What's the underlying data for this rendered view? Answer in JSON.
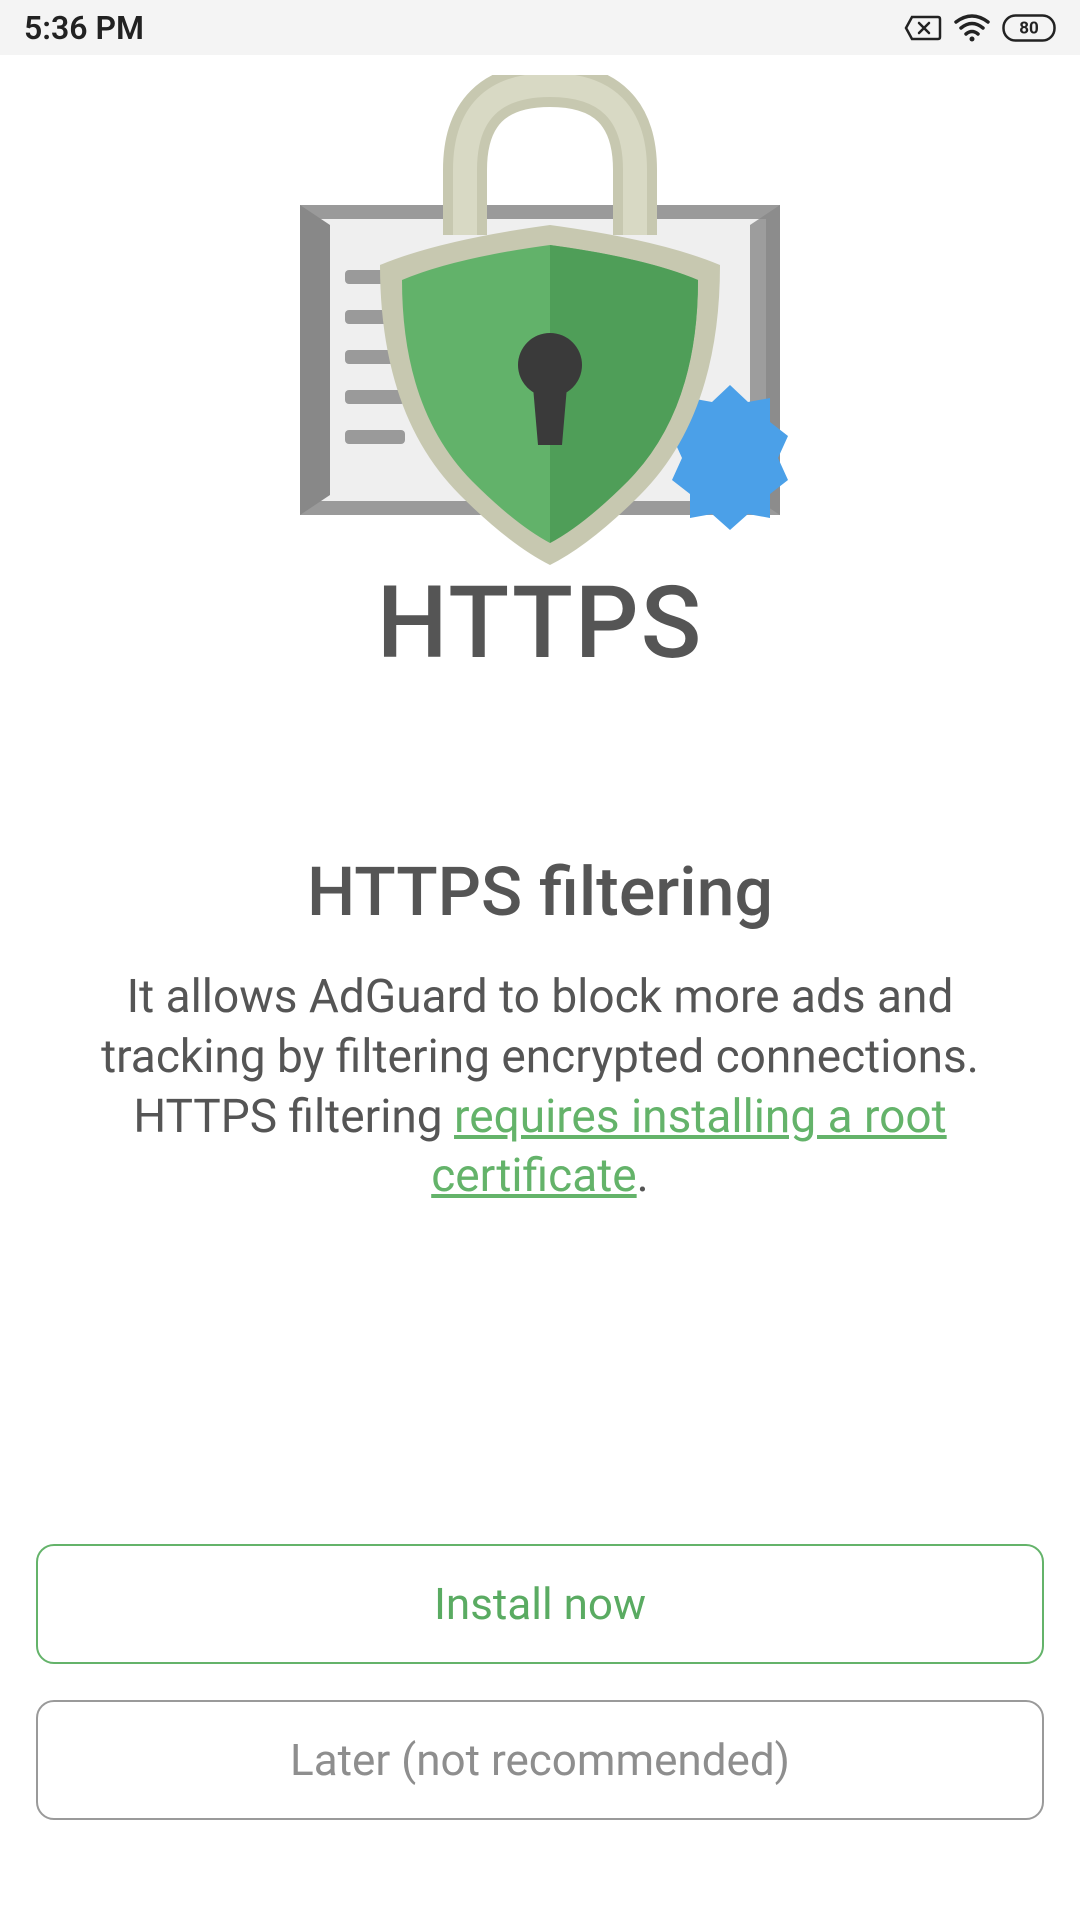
{
  "status": {
    "time": "5:36 PM",
    "battery": "80"
  },
  "hero": {
    "title": "HTTPS"
  },
  "section": {
    "title": "HTTPS filtering",
    "desc_part1": "It allows AdGuard to block more ads and tracking by filtering encrypted connections. HTTPS filtering ",
    "link_text": "requires installing a root certificate",
    "desc_part2": "."
  },
  "buttons": {
    "primary": "Install now",
    "secondary": "Later (not recommended)"
  }
}
